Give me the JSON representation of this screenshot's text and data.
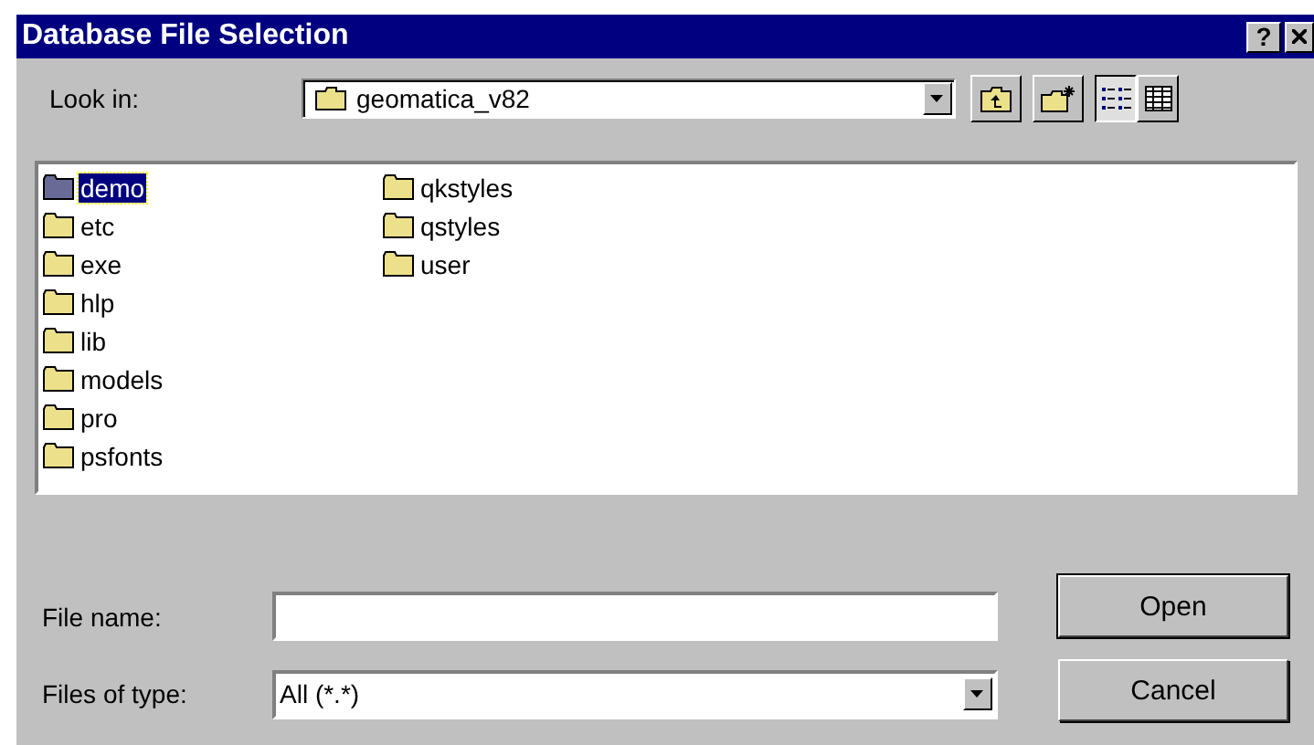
{
  "window": {
    "title": "Database File Selection",
    "help_button": "?"
  },
  "look_in": {
    "label": "Look in:",
    "value": "geomatica_v82"
  },
  "toolbar": [
    {
      "kind": "up"
    },
    {
      "kind": "new-folder"
    },
    {
      "kind": "list",
      "selected": true
    },
    {
      "kind": "details",
      "selected": false
    }
  ],
  "files": [
    {
      "name": "demo",
      "selected": true
    },
    {
      "name": "etc",
      "selected": false
    },
    {
      "name": "exe",
      "selected": false
    },
    {
      "name": "hlp",
      "selected": false
    },
    {
      "name": "lib",
      "selected": false
    },
    {
      "name": "models",
      "selected": false
    },
    {
      "name": "pro",
      "selected": false
    },
    {
      "name": "psfonts",
      "selected": false
    },
    {
      "name": "qkstyles",
      "selected": false
    },
    {
      "name": "qstyles",
      "selected": false
    },
    {
      "name": "user",
      "selected": false
    }
  ],
  "file_name": {
    "label": "File name:"
  },
  "file_type": {
    "label": "Files of type:",
    "value": "All (*.*)"
  },
  "buttons": [
    "Open",
    "Cancel"
  ]
}
